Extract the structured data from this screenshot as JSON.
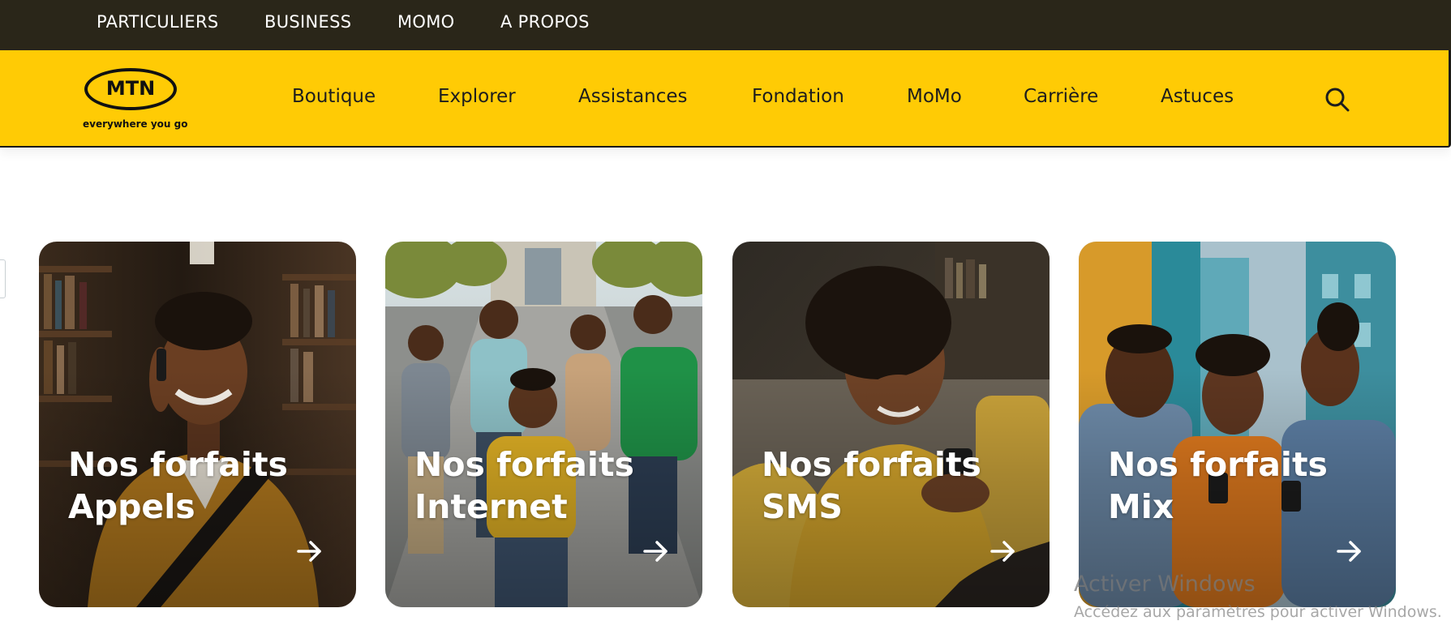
{
  "topbar": {
    "items": [
      "PARTICULIERS",
      "BUSINESS",
      "MOMO",
      "A PROPOS"
    ]
  },
  "brand": {
    "name": "MTN",
    "tagline": "everywhere you go",
    "yellow": "#ffcb05",
    "dark": "#2a2619"
  },
  "nav": {
    "items": [
      "Boutique",
      "Explorer",
      "Assistances",
      "Fondation",
      "MoMo",
      "Carrière",
      "Astuces"
    ],
    "search_icon": "search-icon"
  },
  "cards": [
    {
      "title": "Nos forfaits\nAppels",
      "icon": "arrow-right-icon"
    },
    {
      "title": "Nos forfaits\nInternet",
      "icon": "arrow-right-icon"
    },
    {
      "title": "Nos forfaits\nSMS",
      "icon": "arrow-right-icon"
    },
    {
      "title": "Nos forfaits\nMix",
      "icon": "arrow-right-icon"
    }
  ],
  "watermark": {
    "line1": "Activer Windows",
    "line2": "Accédez aux paramètres pour activer Windows."
  }
}
